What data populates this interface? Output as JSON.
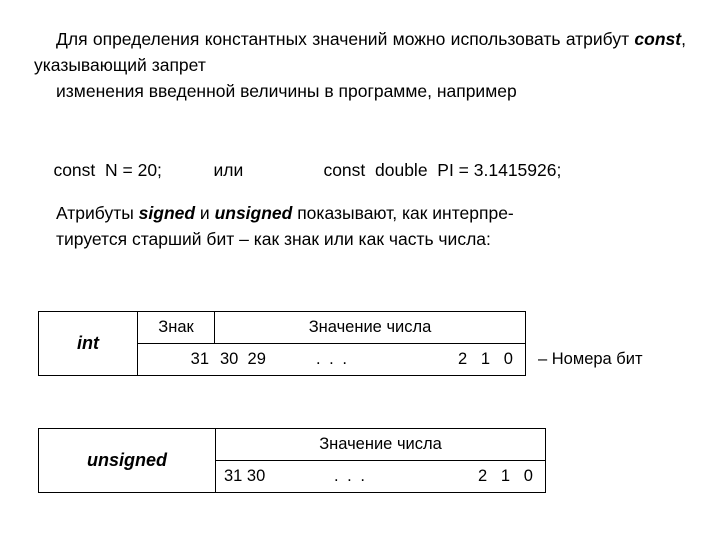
{
  "paragraph1": {
    "line1": "Для   определения   константных   значений   можно",
    "line2_a": "использовать   атрибут   ",
    "line2_kw": "const",
    "line2_b": ",   указывающий   запрет",
    "line3": "изменения введенной величины в программе, например"
  },
  "code": {
    "const_n": "const  N = 20;",
    "or": "или",
    "const_pi": "const  double  PI = 3.1415926;"
  },
  "paragraph2": {
    "a": "Атрибуты ",
    "signed": "signed",
    "b": " и ",
    "unsigned": "unsigned",
    "c": " показывают,  как  интерпре-",
    "line2": "тируется старший  бит – как  знак  или  как часть числа:"
  },
  "table_int": {
    "row_label": "int",
    "header_sign": "Знак",
    "header_value": "Значение числа",
    "bit_31": "31",
    "bits_high": "30  29",
    "dots": ". . .",
    "bits_low": "2   1   0"
  },
  "note": "– Номера бит",
  "table_unsigned": {
    "row_label": "unsigned",
    "header_value": "Значение числа",
    "bits_high": "31 30",
    "dots": ". . .",
    "bits_low": "2   1   0"
  }
}
